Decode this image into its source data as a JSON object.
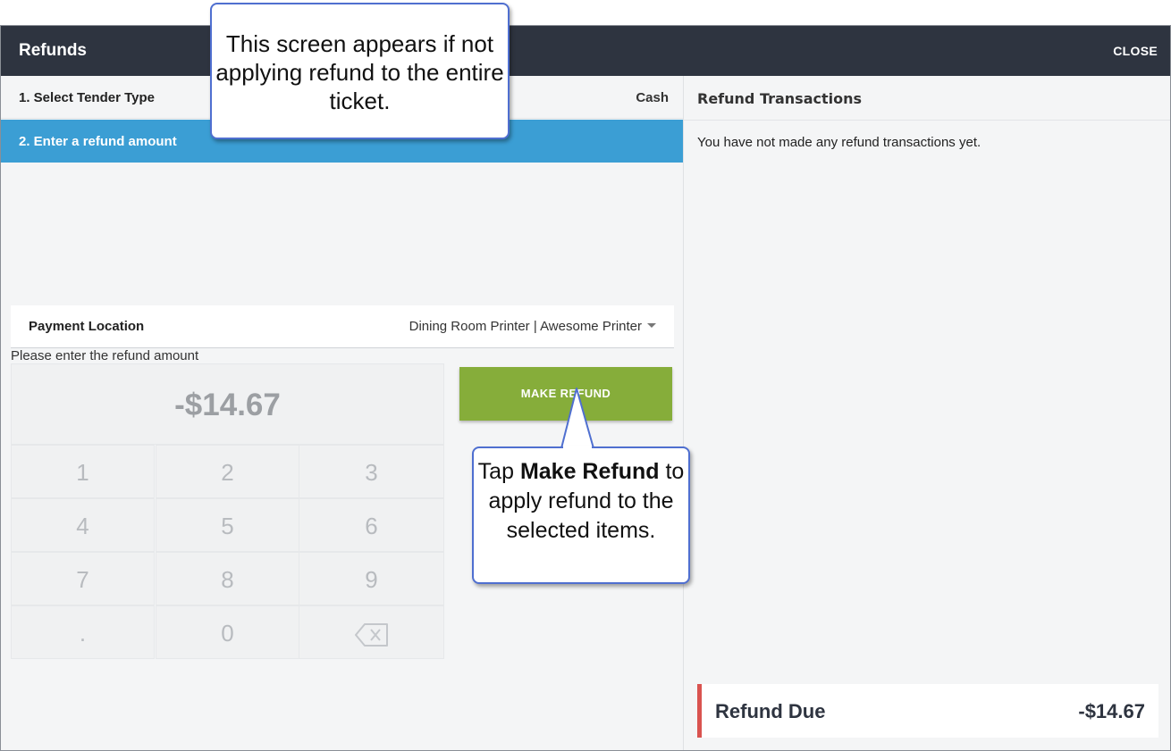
{
  "window": {
    "title": "Refunds",
    "close_label": "CLOSE"
  },
  "steps": [
    {
      "label": "1. Select Tender Type",
      "value": "Cash"
    },
    {
      "label": "2. Enter a refund amount"
    }
  ],
  "payment_location": {
    "label": "Payment Location",
    "selected": "Dining Room Printer | Awesome Printer"
  },
  "prompt": "Please enter the refund amount",
  "amount": "-$14.67",
  "keypad": {
    "keys": [
      "1",
      "2",
      "3",
      "4",
      "5",
      "6",
      "7",
      "8",
      "9",
      ".",
      "0"
    ],
    "backspace_icon": "backspace-icon"
  },
  "make_refund_label": "MAKE REFUND",
  "transactions": {
    "title": "Refund Transactions",
    "empty_message": "You have not made any refund transactions yet."
  },
  "refund_due": {
    "label": "Refund Due",
    "value": "-$14.67"
  },
  "callouts": {
    "top": "This screen appears if not applying refund to the entire ticket.",
    "bottom_pre": "Tap ",
    "bottom_bold": "Make Refund",
    "bottom_post": " to apply refund to the selected items."
  },
  "colors": {
    "titlebar": "#2e3440",
    "active_step": "#3b9ed4",
    "make_refund": "#86ad3a",
    "refund_due_accent": "#d9534f",
    "callout_border": "#4f6fd0"
  }
}
